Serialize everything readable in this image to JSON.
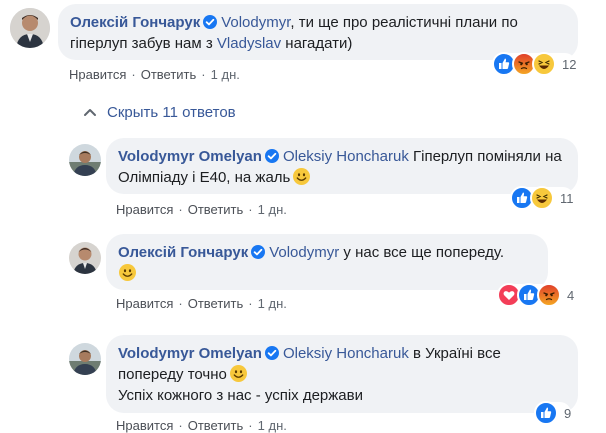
{
  "comments": [
    {
      "author": "Олексій Гончарук",
      "mention": "Volodymyr",
      "text_a": ", ти ще про реалістичні плани по гіперлуп забув нам з ",
      "mention2": "Vladyslav",
      "text_b": " нагадати)",
      "like": "Нравится",
      "reply": "Ответить",
      "time": "1 дн.",
      "reaction_count": "12",
      "reactions": [
        "like",
        "angry",
        "haha"
      ]
    },
    {
      "author": "Volodymyr Omelyan",
      "mention": "Oleksiy Honcharuk",
      "text_a": " Гіперлуп поміняли на Олімпіаду і E40, на жаль",
      "like": "Нравится",
      "reply": "Ответить",
      "time": "1 дн.",
      "reaction_count": "11",
      "reactions": [
        "like",
        "haha"
      ]
    },
    {
      "author": "Олексій Гончарук",
      "mention": "Volodymyr",
      "text_a": " у нас все ще попереду.",
      "like": "Нравится",
      "reply": "Ответить",
      "time": "1 дн.",
      "reaction_count": "4",
      "reactions": [
        "love",
        "like",
        "angry"
      ]
    },
    {
      "author": "Volodymyr Omelyan",
      "mention": "Oleksiy Honcharuk",
      "text_a": " в Україні все попереду точно",
      "text_b": "Успіх кожного з нас - успіх держави",
      "like": "Нравится",
      "reply": "Ответить",
      "time": "1 дн.",
      "reaction_count": "9",
      "reactions": [
        "like"
      ]
    }
  ],
  "hide_replies_label": "Скрыть 11 ответов",
  "colors": {
    "link": "#385898",
    "bubble": "#f0f2f5",
    "like_blue": "#1877f2",
    "angry_orange": "#e9710f",
    "love_red": "#f33e58",
    "haha_yellow": "#f7c83c"
  },
  "icons": [
    "verified-badge-icon",
    "chevron-up-icon",
    "like-reaction-icon",
    "angry-reaction-icon",
    "haha-reaction-icon",
    "love-reaction-icon",
    "smile-emoji-icon"
  ]
}
